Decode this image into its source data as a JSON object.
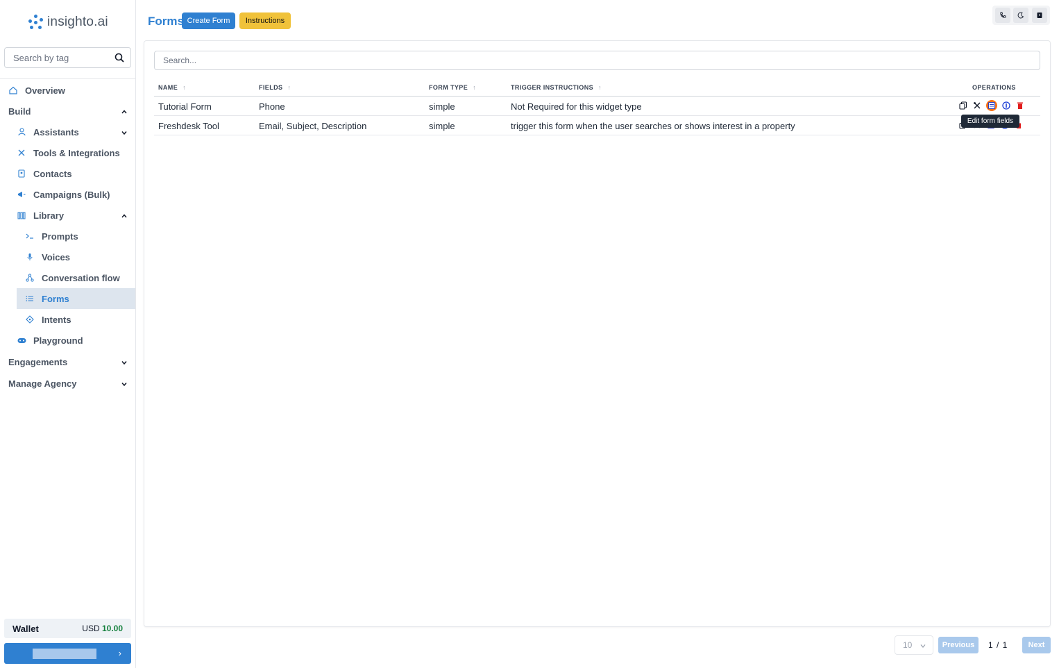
{
  "brand": {
    "name": "insighto.ai"
  },
  "sidebar": {
    "search_placeholder": "Search by tag",
    "overview": "Overview",
    "build": "Build",
    "assistants": "Assistants",
    "tools": "Tools & Integrations",
    "contacts": "Contacts",
    "campaigns": "Campaigns (Bulk)",
    "library": "Library",
    "prompts": "Prompts",
    "voices": "Voices",
    "conversation_flow": "Conversation flow",
    "forms": "Forms",
    "intents": "Intents",
    "playground": "Playground",
    "engagements": "Engagements",
    "manage_agency": "Manage Agency",
    "active_item": "Forms"
  },
  "wallet": {
    "label": "Wallet",
    "currency": "USD",
    "amount": "10.00"
  },
  "header": {
    "title": "Forms",
    "create_button": "Create Form",
    "instructions_button": "Instructions"
  },
  "table": {
    "search_placeholder": "Search...",
    "columns": {
      "name": "NAME",
      "fields": "FIELDS",
      "form_type": "FORM TYPE",
      "trigger": "TRIGGER INSTRUCTIONS",
      "operations": "OPERATIONS"
    },
    "rows": [
      {
        "name": "Tutorial Form",
        "fields": "Phone",
        "form_type": "simple",
        "trigger": "Not Required for this widget type"
      },
      {
        "name": "Freshdesk Tool",
        "fields": "Email, Subject, Description",
        "form_type": "simple",
        "trigger": "trigger this form when the user searches or shows interest in a property"
      }
    ],
    "tooltip": "Edit form fields"
  },
  "pagination": {
    "page_size": "10",
    "previous": "Previous",
    "indicator": "1 / 1",
    "next": "Next"
  },
  "colors": {
    "accent": "#2f80d1",
    "instructions": "#f0c23a",
    "delete": "#e11d1d",
    "highlight": "#f97316"
  }
}
